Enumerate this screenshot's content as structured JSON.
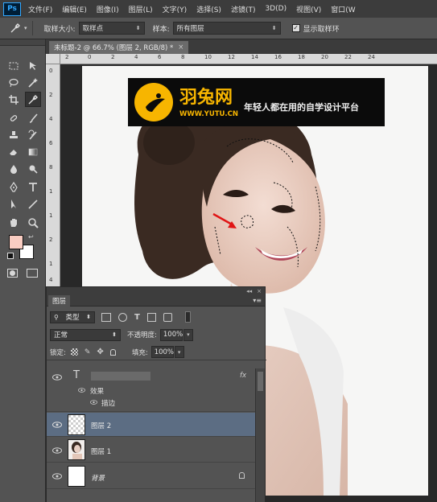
{
  "app": {
    "logo_text": "Ps"
  },
  "menu": [
    "文件(F)",
    "编辑(E)",
    "图像(I)",
    "图层(L)",
    "文字(Y)",
    "选择(S)",
    "滤镜(T)",
    "3D(D)",
    "视图(V)",
    "窗口(W"
  ],
  "options": {
    "sample_size_label": "取样大小:",
    "sample_size_value": "取样点",
    "sample_label": "样本:",
    "sample_value": "所有图层",
    "show_ring_label": "显示取样环",
    "show_ring_checked": true
  },
  "document": {
    "tab_title": "未标题-2 @ 66.7% (图层 2, RGB/8) *",
    "close": "×"
  },
  "ruler": {
    "top_ticks": [
      "2",
      "0",
      "2",
      "4",
      "6",
      "8",
      "10",
      "12",
      "14",
      "16",
      "18",
      "20",
      "22",
      "24"
    ],
    "left_ticks": [
      "0",
      "2",
      "4",
      "6",
      "8",
      "1",
      "1",
      "2",
      "1",
      "4",
      "1"
    ]
  },
  "watermark": {
    "title": "羽兔网",
    "url": "WWW.YUTU.CN",
    "slogan": "年轻人都在用的自学设计平台"
  },
  "colors": {
    "foreground": "#f9cdc2",
    "background": "#ffffff",
    "accent": "#f7b500",
    "selected_layer": "#5c6d83"
  },
  "layers_panel": {
    "tab_label": "图层",
    "collapse": "◂◂",
    "close": "×",
    "menu": "▾≡",
    "filter_label": "类型",
    "blend_mode": "正常",
    "opacity_label": "不透明度:",
    "opacity_value": "100%",
    "lock_label": "锁定:",
    "fill_label": "填充:",
    "fill_value": "100%",
    "layers": [
      {
        "name": "",
        "type": "text",
        "fx": "fx",
        "effects_label": "效果",
        "effect": "描边"
      },
      {
        "name": "图层 2",
        "type": "pixel",
        "selected": true
      },
      {
        "name": "图层 1",
        "type": "pixel"
      },
      {
        "name": "背景",
        "type": "background",
        "locked": true
      }
    ]
  }
}
